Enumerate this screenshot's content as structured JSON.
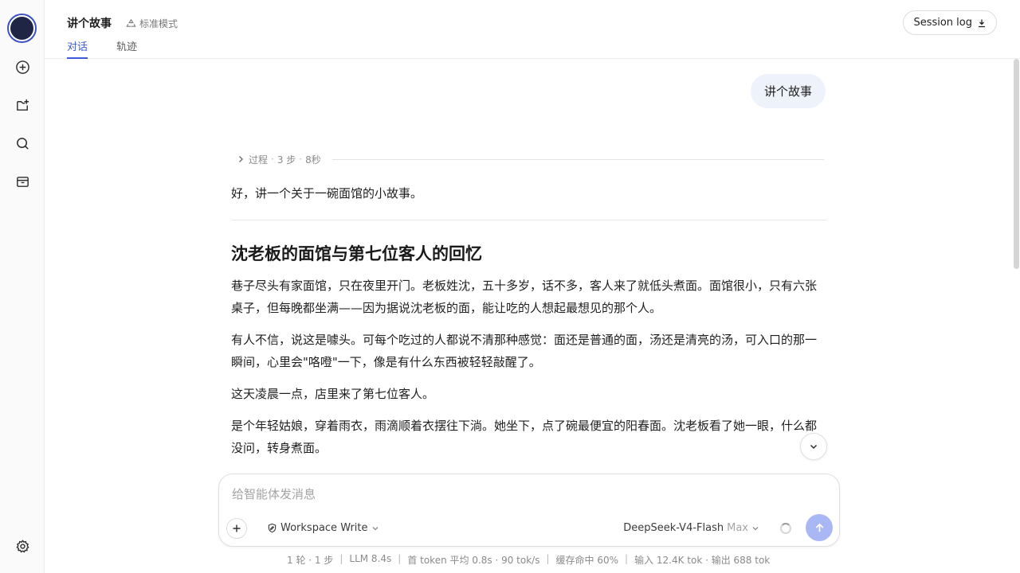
{
  "header": {
    "title": "讲个故事",
    "mode": "标准模式",
    "tabs": [
      {
        "label": "对话",
        "active": true
      },
      {
        "label": "轨迹",
        "active": false
      }
    ],
    "session_log": "Session log"
  },
  "sidebar": {
    "icons": [
      "logo",
      "new-chat-icon",
      "new-project-icon",
      "search-icon",
      "archive-icon",
      "settings-icon"
    ]
  },
  "conversation": {
    "user_message": "讲个故事",
    "process": {
      "label": "过程",
      "steps": "3 步",
      "time": "8秒"
    },
    "intro": "好，讲一个关于一碗面馆的小故事。",
    "story_title": "沈老板的面馆与第七位客人的回忆",
    "paragraphs": [
      "巷子尽头有家面馆，只在夜里开门。老板姓沈，五十多岁，话不多，客人来了就低头煮面。面馆很小，只有六张桌子，但每晚都坐满——因为据说沈老板的面，能让吃的人想起最想见的那个人。",
      "有人不信，说这是噱头。可每个吃过的人都说不清那种感觉：面还是普通的面，汤还是清亮的汤，可入口的那一瞬间，心里会\"咯噔\"一下，像是有什么东西被轻轻敲醒了。",
      "这天凌晨一点，店里来了第七位客人。",
      "是个年轻姑娘，穿着雨衣，雨滴顺着衣摆往下淌。她坐下，点了碗最便宜的阳春面。沈老板看了她一眼，什么都没问，转身煮面。"
    ]
  },
  "composer": {
    "placeholder": "给智能体发消息",
    "workspace": "Workspace Write",
    "model": "DeepSeek-V4-Flash",
    "level": "Max"
  },
  "stats": {
    "rounds": "1 轮 · 1 步",
    "llm": "LLM 8.4s",
    "first_token": "首 token 平均 0.8s · 90 tok/s",
    "cache": "缓存命中 60%",
    "tokens": "输入 12.4K tok · 输出 688 tok"
  },
  "colors": {
    "accent": "#3b5bdb",
    "send_button": "#a9b8f5",
    "user_bubble": "#eef2fb"
  }
}
